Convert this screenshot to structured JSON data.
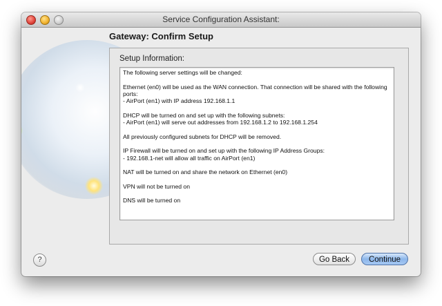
{
  "window": {
    "title": "Service Configuration Assistant:",
    "close_icon": "close-icon",
    "minimize_icon": "minimize-icon",
    "zoom_icon": "zoom-icon"
  },
  "page": {
    "heading": "Gateway: Confirm Setup"
  },
  "setup_info": {
    "label": "Setup Information:",
    "paragraphs": [
      "The following server settings will be changed:",
      "Ethernet (en0) will be used as the WAN connection. That connection will be shared with the following ports:\n - AirPort (en1) with IP address 192.168.1.1",
      "DHCP will be turned on and set up with the following subnets:\n - AirPort (en1) will serve out addresses from 192.168.1.2 to 192.168.1.254",
      "All previously configured subnets for DHCP will be removed.",
      "IP Firewall will be turned on and set up with the following IP Address Groups:\n - 192.168.1-net will allow all traffic on AirPort (en1)",
      "NAT will be turned on and share the network on Ethernet (en0)",
      "VPN will not be turned on",
      "DNS will be turned on"
    ]
  },
  "buttons": {
    "help": "?",
    "go_back": "Go Back",
    "continue": "Continue"
  },
  "colors": {
    "accent": "#8db7ea",
    "window_bg": "#ececec"
  }
}
